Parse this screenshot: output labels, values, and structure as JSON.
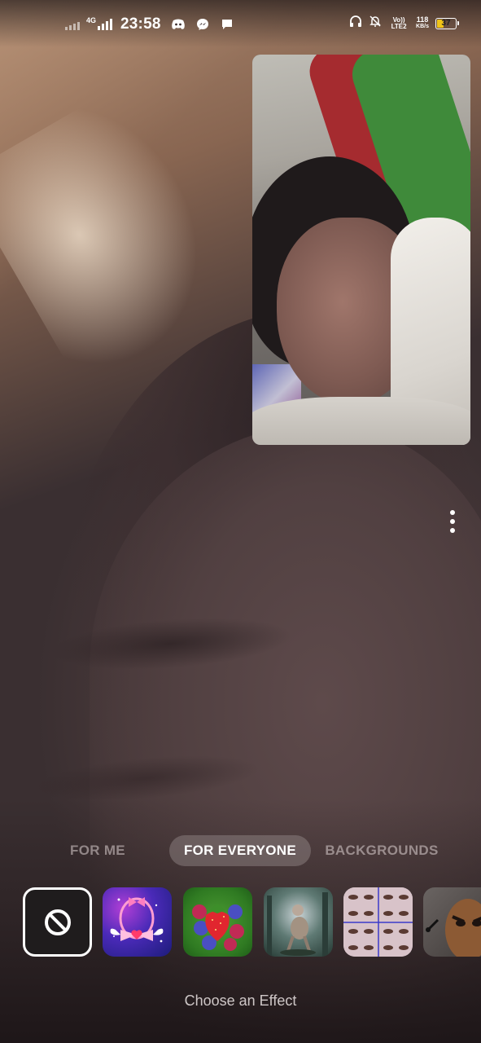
{
  "status_bar": {
    "network_type": "4G",
    "time": "23:58",
    "volte": "Vo)) LTE2",
    "speed_value": "118",
    "speed_unit": "KB/s",
    "battery_level": "37",
    "battery_fraction": 0.37,
    "battery_color": "#f0c419",
    "icons_left": [
      "signal-weak-icon",
      "signal-4g-icon",
      "discord-icon",
      "messenger-icon",
      "message-icon"
    ],
    "icons_right": [
      "headphones-icon",
      "mute-bell-icon",
      "volte-icon",
      "network-speed-icon",
      "battery-icon"
    ]
  },
  "call": {
    "more_options_icon": "more-vertical-icon"
  },
  "effects_panel": {
    "tabs": [
      {
        "label": "FOR ME",
        "active": false
      },
      {
        "label": "FOR EVERYONE",
        "active": true
      },
      {
        "label": "BACKGROUNDS",
        "active": false
      }
    ],
    "effects": [
      {
        "name": "no-effect",
        "icon": "block-icon",
        "selected": true
      },
      {
        "name": "pink-bow-effect",
        "icon": "bow-heart-icon",
        "selected": false
      },
      {
        "name": "berries-effect",
        "icon": "strawberry-icon",
        "selected": false
      },
      {
        "name": "forest-creature-effect",
        "icon": "creature-icon",
        "selected": false
      },
      {
        "name": "eyes-grid-effect",
        "icon": "eyes-grid-icon",
        "selected": false
      },
      {
        "name": "bean-character-effect",
        "icon": "bean-character-icon",
        "selected": false
      }
    ],
    "caption": "Choose an Effect"
  },
  "colors": {
    "accent_white": "#ffffff",
    "tab_inactive": "#b8aeae",
    "tab_active_bg": "#8c8282"
  }
}
